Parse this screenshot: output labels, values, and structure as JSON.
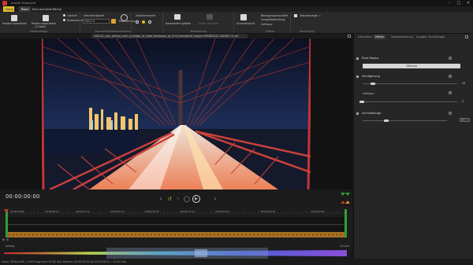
{
  "window": {
    "title": "avsoft Videoprof",
    "minimize_icon": "minimize-icon",
    "maximize_icon": "maximize-icon",
    "close_icon": "close-icon"
  },
  "ribbon": {
    "tabs": [
      {
        "label": "Datei",
        "active": false
      },
      {
        "label": "Start",
        "active": true
      },
      {
        "label": "Benutzeroberfläche",
        "active": false
      }
    ],
    "import_media": "Medien importieren",
    "export_media": "Medien exportieren",
    "export_media_sub": "(1 Datei)",
    "group_media": "Medienablage",
    "delete": "Löschen",
    "rename": "Umbenennen",
    "speed_label": "Geschwindigkeit",
    "speed_value": "100,0 %",
    "fade_label": "Überblenden",
    "group_speed": "Geschwindigkeitseinstellung",
    "between_label": "Zwischenmarke",
    "capture": "Standbild speichern",
    "keyframes": "Keyframes",
    "camera": "Kamerafahrt glätten",
    "track_obj": "Objekt verfolgen",
    "group_edit": "Bearbeitung",
    "quick_label": "Schnellansicht",
    "motion": "Bewegungsunschärfe",
    "slow": "Langzeitbelichtung",
    "light": "Lichtspur",
    "group_effects": "Effekte",
    "view_label": "Statusanzeige",
    "group_display": "Darstellung"
  },
  "file_tab": "100131_cars_driving_over_a_bridge_at_night_timelapse_by_Erik_Nuenighoff_stegutr.991805422-CADHD (1).avi",
  "player": {
    "timecode": "00:00:00:00",
    "prev_icon": "previous-icon",
    "skip_back_icon": "skip-back-icon",
    "stop_icon": "stop-icon",
    "play_icon": "play-icon",
    "next_icon": "next-icon"
  },
  "timeline": {
    "ticks": [
      "00:00:00:00",
      "00:00:00:10",
      "00:00:01:10",
      "00:00:02:10",
      "00:00:03:10",
      "00:00:04:10",
      "00:00:05:10",
      "00:00:06:10",
      "00:00:07:10"
    ],
    "start_label": "Anfang",
    "end_label": "Schluss"
  },
  "status": {
    "text": "Video: 3840x2160, 1.000   Programm: 8.542 Sek.   Bereich: 00:00:00:00 bis 00:00:08:07 = 8.542 Sek."
  },
  "side": {
    "tabs": [
      "Information",
      "Effekte",
      "Videobearbeitung",
      "Ausgabe: Einstellungen"
    ],
    "active_tab": "Effekte",
    "pixel_section": "Pixel-Modus",
    "pixel_button": "Glättung",
    "reduction_section": "Verzögerung",
    "reduction_value": "16",
    "bright_label": "Lichtspur",
    "bright_value": "0",
    "shadow_section": "Schneidlänge",
    "shadow_value": "77"
  },
  "colors": {
    "accent": "#e0bd2e",
    "timeline_clip": "#a86f24",
    "playhead_green": "#2f9e3a",
    "marker_red": "#c0392b"
  }
}
